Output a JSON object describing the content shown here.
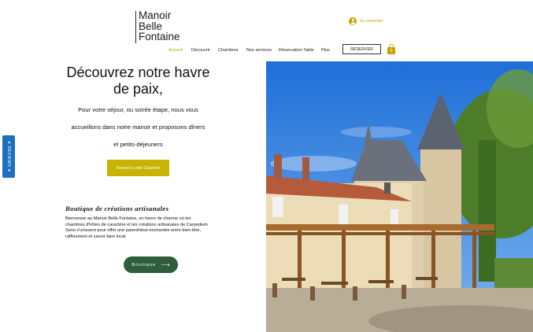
{
  "header": {
    "logo_lines": [
      "Manoir",
      "Belle",
      "Fontaine"
    ],
    "login_label": "Se connecter",
    "reserve_label": "RÉSERVER",
    "cart_count": "0"
  },
  "nav": {
    "items": [
      "Accueil",
      "Découvrir",
      "Chambres",
      "Nos services",
      "Réservation Table",
      "Plus"
    ],
    "active": "Accueil"
  },
  "hero": {
    "title_line1": "Découvrez notre havre",
    "title_line2": "de paix,",
    "text_line1": "Pour votre séjour, ou soirée étape, nous vous",
    "text_line2": "accueillons dans notre manoir et proposons dîners",
    "text_line3": "et petits-déjeuners",
    "cta_label": "Reservez votre Chambre"
  },
  "shop": {
    "heading": "Boutique de créations artisanales",
    "text_line1": "Bienvenue au Manoir Belle Fontaine, un havre de charme où les",
    "text_line2": "chambres d'hôtes de caractère et les créations artisanales de Carpediem",
    "text_line3": "Sens s'unissent pour offrir une parenthèse enchantée entre bien-être,",
    "text_line4": "raffinement et savoir-faire local.",
    "button_label": "Boutique",
    "button_arrow": "⟶"
  },
  "reviews_tab": {
    "label": "★ REVIEWS ★"
  },
  "colors": {
    "accent": "#c9b200",
    "shop_button": "#2e5e3c",
    "reviews_tab": "#1e6fbf"
  }
}
